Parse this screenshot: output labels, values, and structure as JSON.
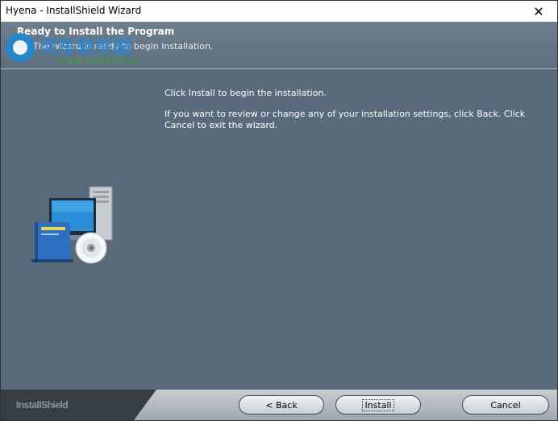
{
  "window": {
    "title": "Hyena - InstallShield Wizard"
  },
  "header": {
    "title": "Ready to Install the Program",
    "subtitle": "The wizard is ready to begin installation."
  },
  "watermark": {
    "site_name": "河东软件园",
    "url": "www.pc0359.cn"
  },
  "body": {
    "line1": "Click Install to begin the installation.",
    "line2": "If you want to review or change any of your installation settings, click Back. Click Cancel to exit the wizard."
  },
  "footer": {
    "brand": "InstallShield",
    "back_label": "< Back",
    "install_label": "Install",
    "cancel_label": "Cancel"
  },
  "icons": [
    "close-icon",
    "computer-install-icon",
    "watermark-logo-icon"
  ],
  "colors": {
    "background": "#596b7a",
    "footer": "#363d44",
    "text": "#ffffff"
  }
}
